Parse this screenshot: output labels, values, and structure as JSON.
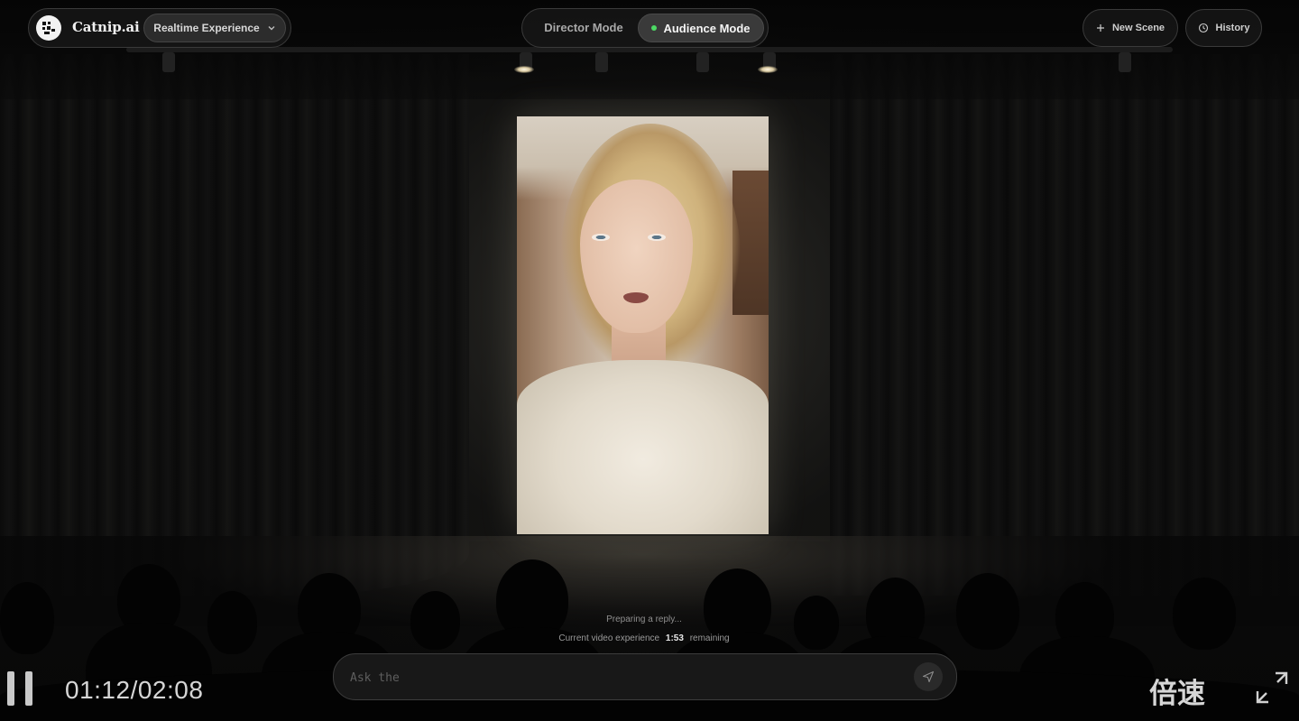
{
  "header": {
    "brand": "Catnip.ai",
    "experience_select": "Realtime Experience",
    "modes": {
      "director": "Director Mode",
      "audience": "Audience Mode"
    },
    "active_mode": "audience",
    "new_scene": "New Scene",
    "history": "History"
  },
  "status": {
    "preparing": "Preparing a reply...",
    "experience_prefix": "Current video experience",
    "remaining_time": "1:53",
    "remaining_suffix": "remaining"
  },
  "input": {
    "placeholder": "Ask the"
  },
  "player": {
    "timecode": "01:12/02:08",
    "speed_label": "倍速"
  },
  "colors": {
    "active_dot": "#4cd964",
    "background": "#070707"
  },
  "icons": [
    "catnip-logo-icon",
    "chevron-down-icon",
    "plus-icon",
    "history-icon",
    "send-icon",
    "pause-icon",
    "fullscreen-icon"
  ]
}
